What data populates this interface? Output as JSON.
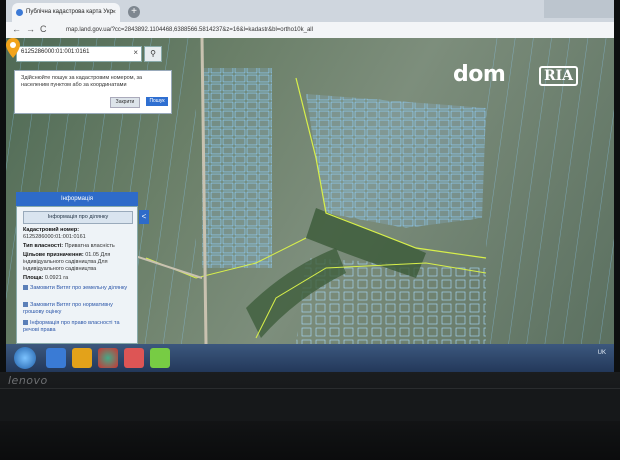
{
  "browser": {
    "tab_title": "Публічна кадастрова карта Укр",
    "tab_close": "×",
    "new_tab": "+",
    "url": "map.land.gov.ua/?cc=2843892.1104468,6388566.5814237&z=16&l=kadastr&bl=ortho10k_all",
    "back_icon": "←",
    "forward_icon": "→",
    "reload_icon": "C"
  },
  "map": {
    "search_value": "6125286000:01:001:0161",
    "search_clear": "×",
    "search_icon": "⚲",
    "tooltip_text": "Здійснюйте пошук за кадастровим номером, за населеним пунктом або за координатами",
    "tooltip_cancel": "Закрити",
    "tooltip_search": "Пошук",
    "collapse_icon": "<"
  },
  "info_panel": {
    "header": "Інформація",
    "subheader": "Інформація про ділянку",
    "cadastral_label": "Кадастровий номер:",
    "cadastral_value": "6125286000:01:001:0161",
    "ownership_label": "Тип власності:",
    "ownership_value": "Приватна власність",
    "purpose_label": "Цільове призначення:",
    "purpose_value": "01.05 Для індивідуального садівництва Для індивідуального садівництва",
    "area_label": "Площа:",
    "area_value": "0.0921 га",
    "link_extract": "Замовити Витяг про земельну ділянку",
    "link_normative": "Замовити Витяг про нормативну грошову оцінку",
    "link_rights": "Інформація про право власності та речові права"
  },
  "watermark": {
    "dom": "dom",
    "ria": "RIA"
  },
  "taskbar": {
    "lang": "UK"
  },
  "laptop": {
    "brand": "lenovo"
  },
  "colors": {
    "accent": "#2e6bc9",
    "parcel_outline": "#8fd0ff",
    "boundary": "#d8f04a",
    "marker": "#f2a31b"
  }
}
